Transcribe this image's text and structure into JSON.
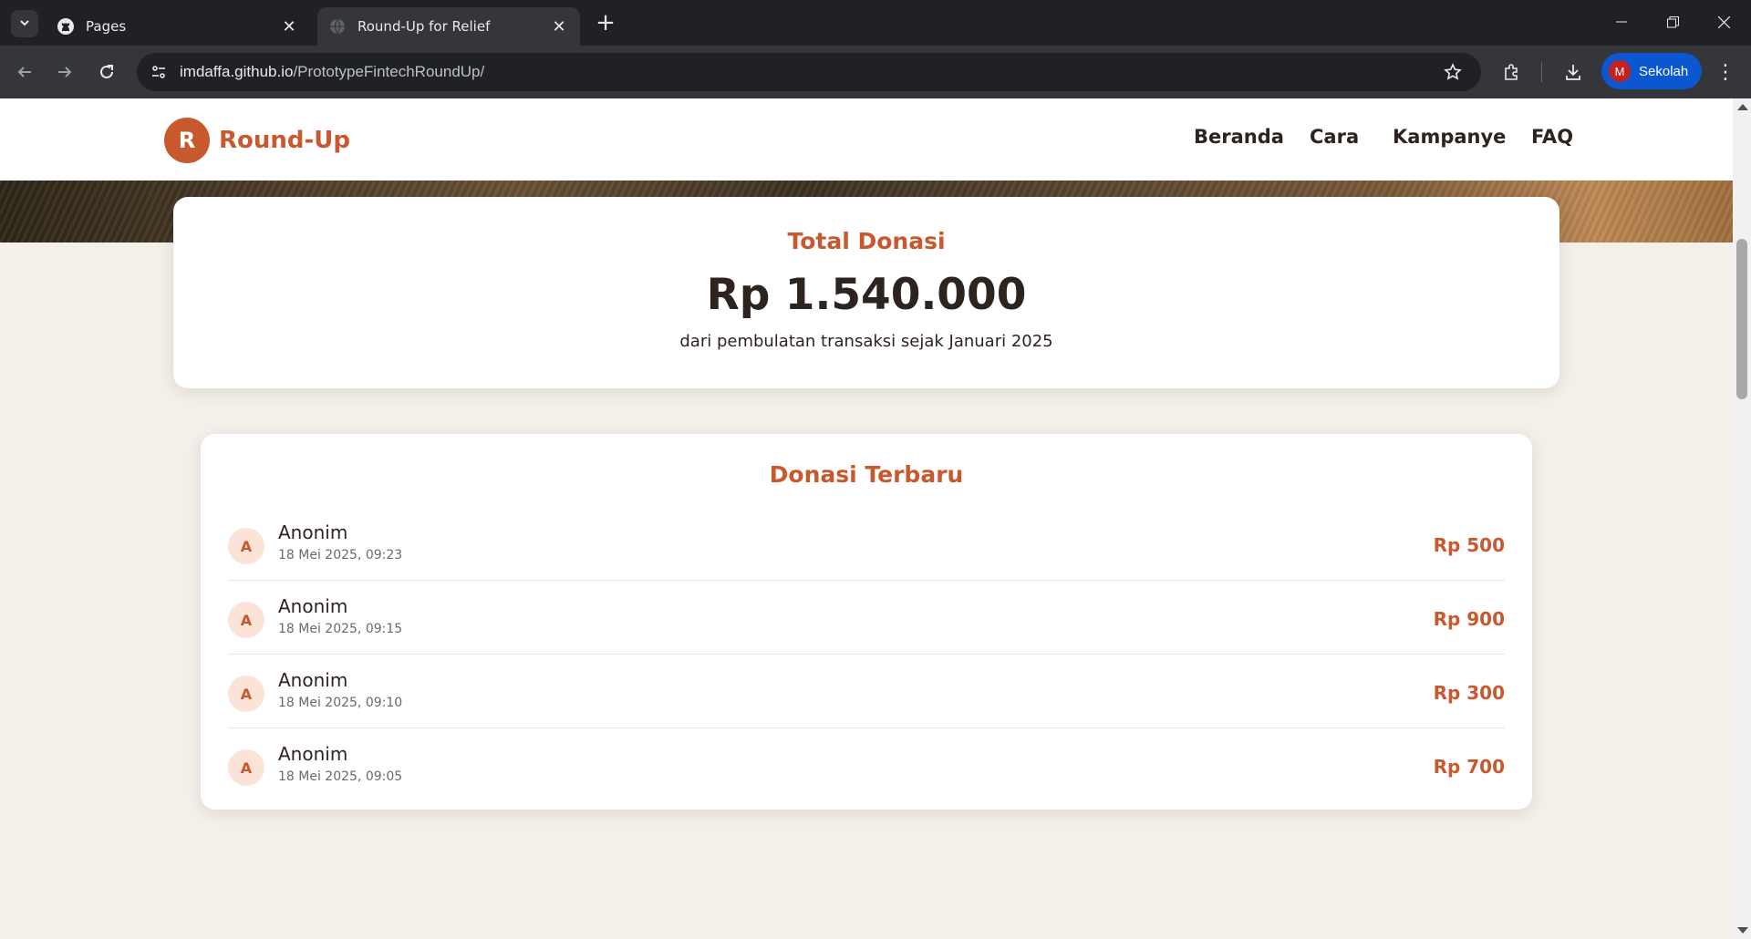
{
  "browser": {
    "tabs": [
      {
        "title": "Pages",
        "icon": "github-icon"
      },
      {
        "title": "Round-Up for Relief",
        "icon": "globe-icon"
      }
    ],
    "url_host": "imdaffa.github.io",
    "url_path": "/PrototypeFintechRoundUp/",
    "profile": {
      "initial": "M",
      "name": "Sekolah"
    }
  },
  "site": {
    "logo_letter": "R",
    "brand": "Round-Up",
    "nav": [
      "Beranda",
      "Cara",
      "Kampanye",
      "FAQ"
    ]
  },
  "total": {
    "label": "Total Donasi",
    "amount": "Rp 1.540.000",
    "subtitle": "dari pembulatan transaksi sejak Januari 2025"
  },
  "recent": {
    "title": "Donasi Terbaru",
    "items": [
      {
        "initial": "A",
        "name": "Anonim",
        "time": "18 Mei 2025, 09:23",
        "amount": "Rp 500"
      },
      {
        "initial": "A",
        "name": "Anonim",
        "time": "18 Mei 2025, 09:15",
        "amount": "Rp 900"
      },
      {
        "initial": "A",
        "name": "Anonim",
        "time": "18 Mei 2025, 09:10",
        "amount": "Rp 300"
      },
      {
        "initial": "A",
        "name": "Anonim",
        "time": "18 Mei 2025, 09:05",
        "amount": "Rp 700"
      }
    ]
  },
  "colors": {
    "accent": "#c8582e",
    "text": "#2d2420",
    "background": "#f4efe9"
  }
}
